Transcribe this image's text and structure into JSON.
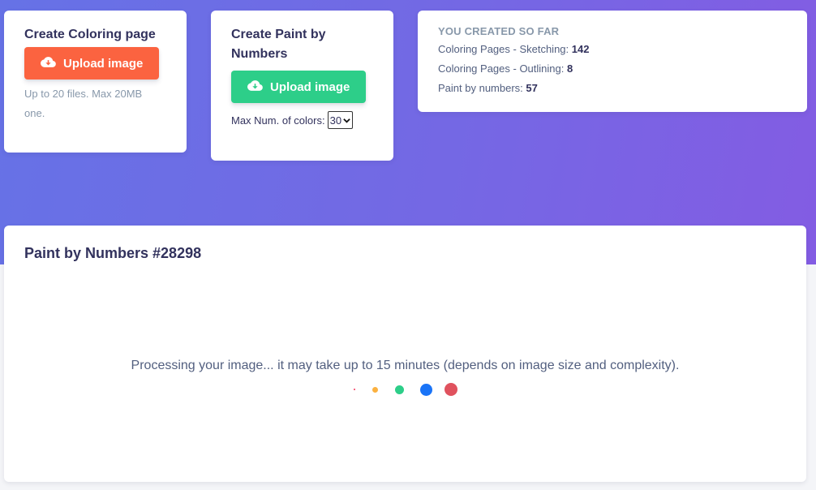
{
  "coloring_card": {
    "title": "Create Coloring page",
    "upload_label": "Upload image",
    "hint": "Up to 20 files. Max 20MB one."
  },
  "pbn_card": {
    "title": "Create Paint by Numbers",
    "upload_label": "Upload image",
    "max_colors_label": "Max Num. of colors:",
    "max_colors_value": "30"
  },
  "stats": {
    "heading": "YOU CREATED SO FAR",
    "lines": [
      {
        "label": "Coloring Pages - Sketching: ",
        "value": "142"
      },
      {
        "label": "Coloring Pages - Outlining: ",
        "value": "8"
      },
      {
        "label": "Paint by numbers: ",
        "value": "57"
      }
    ]
  },
  "result": {
    "title": "Paint by Numbers #28298",
    "processing_text": "Processing your image... it may take up to 15 minutes (depends on image size and complexity).",
    "loader_colors": [
      "#f5365c",
      "#fbb140",
      "#2dce89",
      "#1a74f7",
      "#e0525e"
    ]
  },
  "colors": {
    "orange": "#fb6340",
    "green": "#2dce89",
    "gradient_start": "#6672e6",
    "gradient_end": "#835ce3"
  }
}
